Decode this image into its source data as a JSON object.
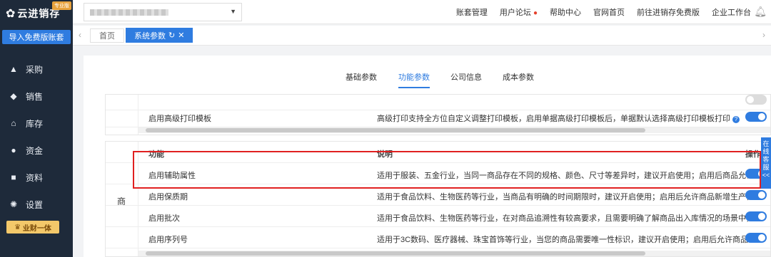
{
  "sidebar": {
    "logo_text": "云进销存",
    "badge": "专业版",
    "import_label": "导入免费版账套",
    "items": [
      {
        "label": "采购",
        "icon": "bag-icon"
      },
      {
        "label": "销售",
        "icon": "tag-icon"
      },
      {
        "label": "库存",
        "icon": "warehouse-icon"
      },
      {
        "label": "资金",
        "icon": "coin-icon"
      },
      {
        "label": "资料",
        "icon": "document-icon"
      },
      {
        "label": "设置",
        "icon": "gear-icon"
      }
    ],
    "promo_label": "业财一体"
  },
  "header": {
    "links": [
      "账套管理",
      "用户论坛",
      "帮助中心",
      "官网首页",
      "前往进销存免费版",
      "企业工作台"
    ]
  },
  "tabs": {
    "home": "首页",
    "active": "系统参数"
  },
  "subtabs": [
    "基础参数",
    "功能参数",
    "公司信息",
    "成本参数"
  ],
  "panel1": {
    "row_func": "启用高级打印模板",
    "row_desc": "高级打印支持全方位自定义调整打印模板，启用单据高级打印模板后，单据默认选择高级打印模板打印"
  },
  "panel2": {
    "side_label": "商",
    "head_func": "功能",
    "head_desc": "说明",
    "head_op": "操作",
    "rows": [
      {
        "func": "启用辅助属性",
        "desc": "适用于服装、五金行业，当同一商品存在不同的规格、颜色、尺寸等差异时，建议开启使用；启用后商品允许录入"
      },
      {
        "func": "启用保质期",
        "desc": "适用于食品饮料、生物医药等行业，当商品有明确的时间期限时，建议开启使用；启用后允许商品新增生产日期"
      },
      {
        "func": "启用批次",
        "desc": "适用于食品饮料、生物医药等行业，在对商品追溯性有较高要求，且需要明确了解商品出入库情况的场景中，建议"
      },
      {
        "func": "启用序列号",
        "desc": "适用于3C数码、医疗器械、珠宝首饰等行业，当您的商品需要唯一性标识，建议开启使用；启用后允许商品新增"
      }
    ]
  },
  "float_service": "在线客服<<"
}
